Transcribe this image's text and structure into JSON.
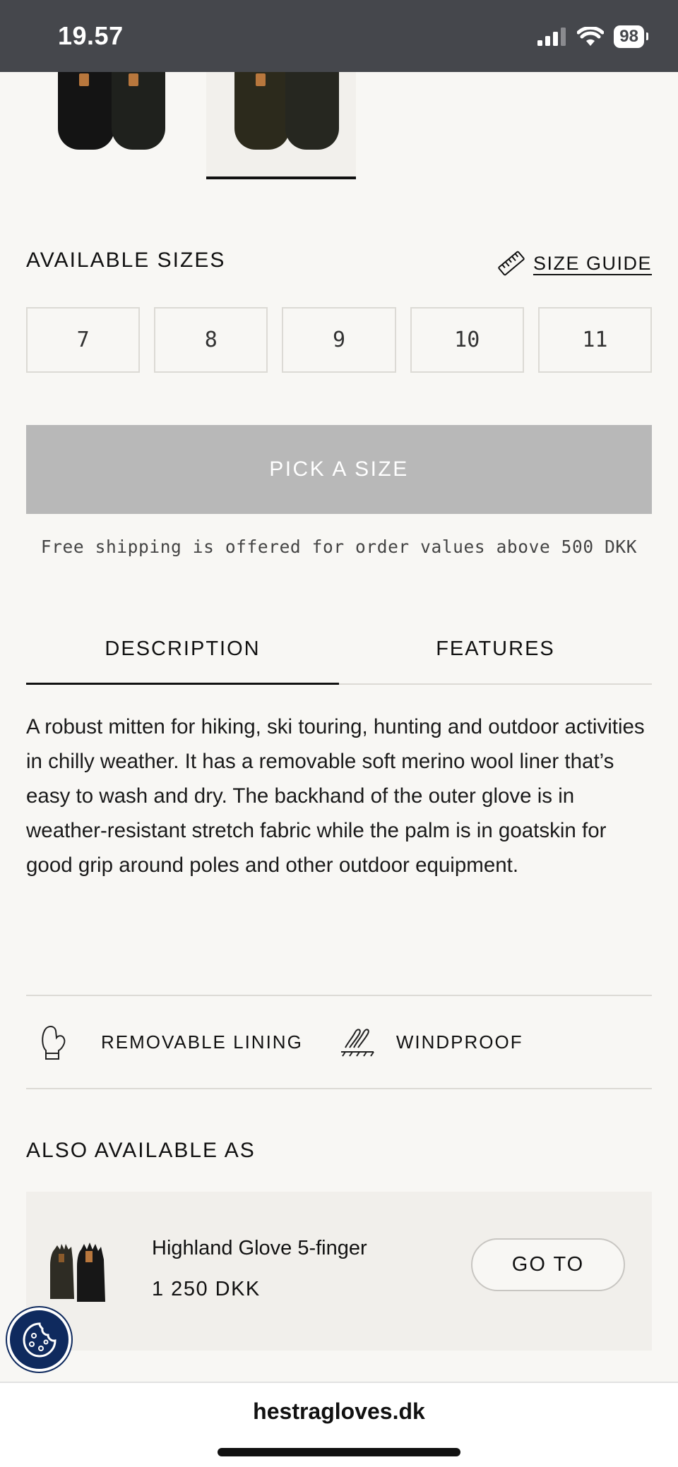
{
  "status_bar": {
    "time": "19.57",
    "battery": "98"
  },
  "sizes": {
    "title": "AVAILABLE SIZES",
    "guide_label": "SIZE GUIDE",
    "options": [
      "7",
      "8",
      "9",
      "10",
      "11"
    ]
  },
  "pick_button": "PICK A SIZE",
  "shipping_note": "Free shipping is offered for order values above 500 DKK",
  "tabs": {
    "description": "DESCRIPTION",
    "features": "FEATURES"
  },
  "description_text": "A robust mitten for hiking, ski touring, hunting and outdoor activities in chilly weather. It has a removable soft merino wool liner that’s easy to wash and dry. The backhand of the outer glove is in weather-resistant stretch fabric while the palm is in goatskin for good grip around poles and other outdoor equipment.",
  "features": [
    {
      "label": "REMOVABLE LINING",
      "icon": "mitten-icon"
    },
    {
      "label": "WINDPROOF",
      "icon": "wind-icon"
    }
  ],
  "also_available": {
    "title": "ALSO AVAILABLE AS",
    "product": {
      "name": "Highland Glove 5-finger",
      "price": "1 250 DKK",
      "button": "GO TO"
    }
  },
  "browser": {
    "url": "hestragloves.dk"
  },
  "colors": {
    "accent_dark": "#111111",
    "disabled_button": "#b8b8b8",
    "cookie_button": "#0f2a5e",
    "status_bar": "#45474c"
  }
}
